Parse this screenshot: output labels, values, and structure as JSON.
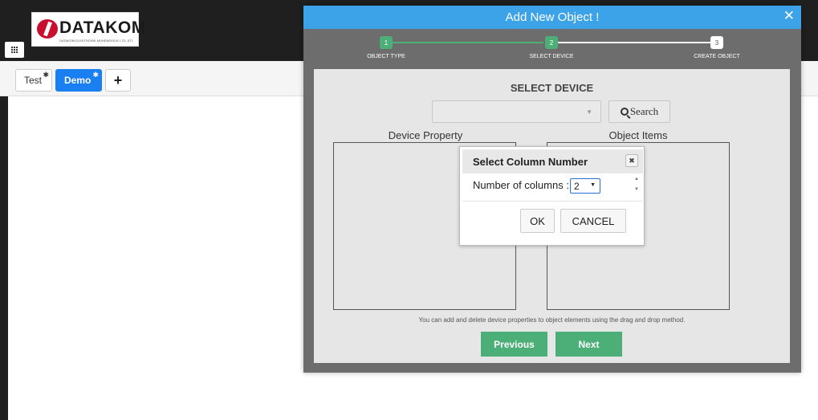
{
  "app": {
    "logo_text": "DATAKOM",
    "logo_subtext": "DATAKOM ELEKTRONIK MÜHENDİSLİK LTD. ŞTİ."
  },
  "tabs": [
    {
      "label": "Test",
      "active": false
    },
    {
      "label": "Demo",
      "active": true
    }
  ],
  "tab_add_label": "+",
  "modal": {
    "title": "Add New Object !",
    "close_label": "✕",
    "steps": [
      {
        "number": "1",
        "label": "OBJECT TYPE",
        "state": "complete"
      },
      {
        "number": "2",
        "label": "SELECT DEVICE",
        "state": "current"
      },
      {
        "number": "3",
        "label": "CREATE OBJECT",
        "state": "pending"
      }
    ],
    "section_title": "SELECT DEVICE",
    "device_select_value": "",
    "search_label": "Search",
    "device_property_title": "Device Property",
    "object_items_title": "Object Items",
    "hint": "You can add and delete device properties to object elements using the drag and drop method.",
    "previous_label": "Previous",
    "next_label": "Next"
  },
  "dialog": {
    "title": "Select Column Number",
    "close_label": "✖",
    "columns_label": "Number of columns :",
    "columns_value": "2",
    "ok_label": "OK",
    "cancel_label": "CANCEL"
  },
  "colors": {
    "header_blue": "#3da3e8",
    "step_green": "#4caf78",
    "tab_active": "#1a7ff0"
  }
}
